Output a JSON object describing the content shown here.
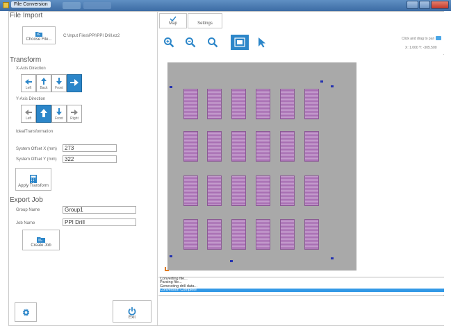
{
  "window": {
    "title": "File Conversion"
  },
  "file_import": {
    "section_title": "File Import",
    "choose_button": "Choose File...",
    "file_path": "C:\\Input Files\\PPI\\PPI Drill.ez2"
  },
  "transform": {
    "section_title": "Transform",
    "x_axis_label": "X-Axis Direction",
    "x_buttons": [
      {
        "label": "Left",
        "selected": false
      },
      {
        "label": "Back",
        "selected": false
      },
      {
        "label": "Front",
        "selected": false
      },
      {
        "label": "",
        "selected": true
      }
    ],
    "y_axis_label": "Y-Axis Direction",
    "y_buttons": [
      {
        "label": "Left",
        "selected": false
      },
      {
        "label": "",
        "selected": true
      },
      {
        "label": "Front",
        "selected": false
      },
      {
        "label": "Right",
        "selected": false
      }
    ],
    "ideal_label": "IdealTransformation",
    "offset_x_label": "System Offset X (mm)",
    "offset_x_value": "273",
    "offset_y_label": "System Offset Y (mm)",
    "offset_y_value": "322",
    "apply_button": "Apply Transform"
  },
  "export_job": {
    "section_title": "Export Job",
    "group_label": "Group Name",
    "group_value": "Group1",
    "job_label": "Job Name",
    "job_value": "PPI Drill",
    "create_button": "Create Job"
  },
  "footer": {
    "exit_label": "Exit"
  },
  "toolbar": {
    "tabs": [
      {
        "label": "Map"
      },
      {
        "label": "Settings"
      }
    ],
    "hint": "Click and drag to pan",
    "coords": "X: 1.000 Y: -305.500"
  },
  "log": {
    "lines": [
      "Converting file...",
      "Parsing file...",
      "Generating drill data...",
      "Conversion Complete"
    ],
    "selected_index": 3
  },
  "colors": {
    "accent": "#2c86c9",
    "plate": "#a9a9a9",
    "drill": "#a86fb3",
    "marker": "#2432b0"
  }
}
